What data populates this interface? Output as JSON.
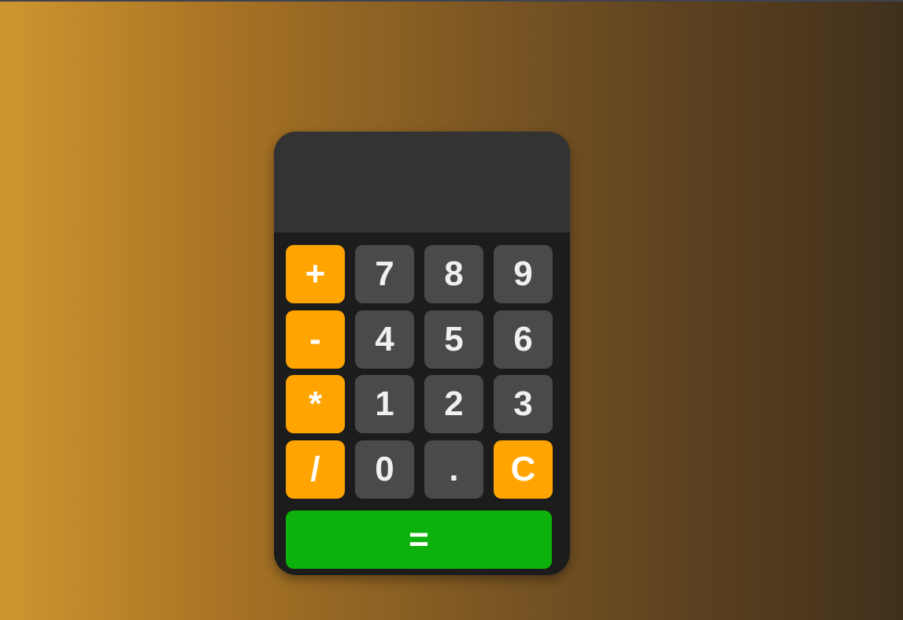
{
  "display": {
    "value": ""
  },
  "colors": {
    "operator": "#ffa400",
    "number": "#4a4a4a",
    "equals": "#0db10b",
    "body": "#1c1c1c",
    "display": "#333333"
  },
  "keys": {
    "plus": "+",
    "minus": "-",
    "multiply": "*",
    "divide": "/",
    "seven": "7",
    "eight": "8",
    "nine": "9",
    "four": "4",
    "five": "5",
    "six": "6",
    "one": "1",
    "two": "2",
    "three": "3",
    "zero": "0",
    "decimal": ".",
    "clear": "C",
    "equals": "="
  }
}
